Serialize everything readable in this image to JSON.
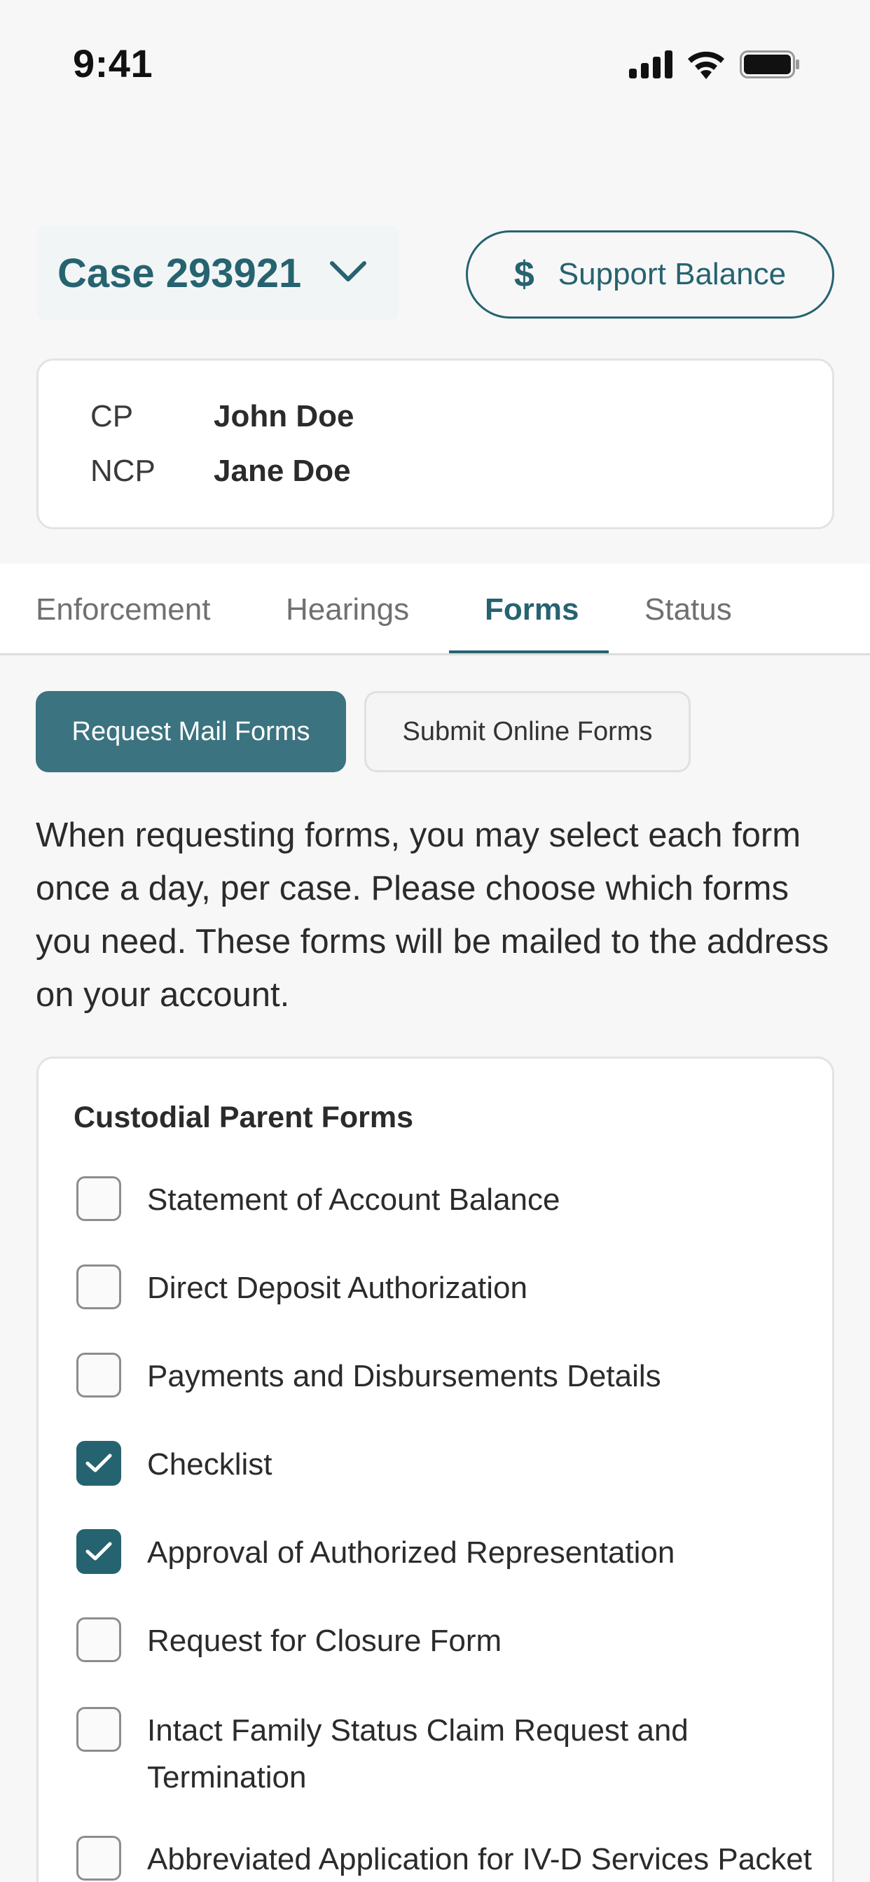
{
  "status_bar": {
    "time": "9:41"
  },
  "case": {
    "title": "Case 293921"
  },
  "support_button": {
    "label": "Support Balance",
    "icon": "dollar-icon"
  },
  "parties": [
    {
      "role": "CP",
      "name": "John Doe"
    },
    {
      "role": "NCP",
      "name": "Jane Doe"
    }
  ],
  "tabs": [
    {
      "label": "Enforcement",
      "active": false
    },
    {
      "label": "Hearings",
      "active": false
    },
    {
      "label": "Forms",
      "active": true
    },
    {
      "label": "Status",
      "active": false
    }
  ],
  "segments": {
    "primary": "Request Mail Forms",
    "secondary": "Submit Online Forms"
  },
  "intro_text": "When requesting forms, you may select each form once a day, per case. Please choose which forms you need. These forms will be mailed to the address on your account.",
  "forms_section": {
    "heading": "Custodial Parent Forms",
    "items": [
      {
        "label": "Statement of Account Balance",
        "checked": false
      },
      {
        "label": "Direct Deposit Authorization",
        "checked": false
      },
      {
        "label": "Payments and Disbursements Details",
        "checked": false
      },
      {
        "label": "Checklist",
        "checked": true
      },
      {
        "label": "Approval of Authorized Representation",
        "checked": true
      },
      {
        "label": "Request for Closure Form",
        "checked": false
      },
      {
        "label": "Intact Family Status Claim Request and Termination",
        "checked": false
      },
      {
        "label": "Abbreviated Application for IV-D Services Packet",
        "checked": false
      }
    ]
  },
  "colors": {
    "accent": "#266370",
    "primary_button": "#3b7380"
  }
}
